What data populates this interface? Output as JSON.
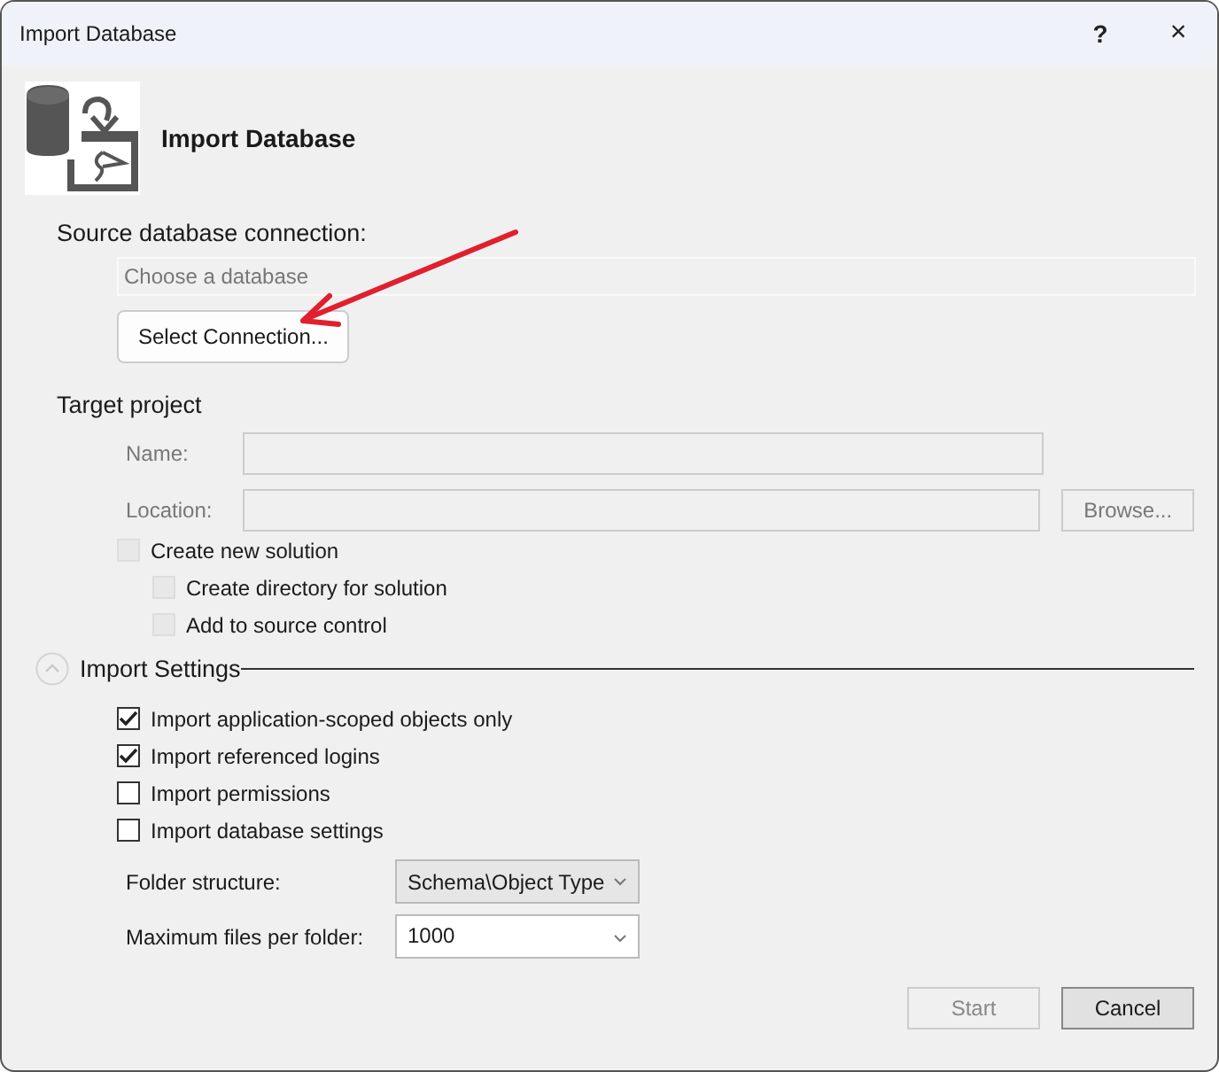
{
  "window": {
    "title": "Import Database",
    "help": "?",
    "close": "×"
  },
  "header": {
    "title": "Import Database"
  },
  "source": {
    "label": "Source database connection:",
    "placeholder": "Choose a database",
    "button": "Select Connection..."
  },
  "target": {
    "heading": "Target project",
    "fields": [
      {
        "label": "Name:",
        "disabled": true
      },
      {
        "label": "Location:",
        "disabled": true,
        "button": "Browse..."
      }
    ],
    "options": [
      {
        "label": "Create new solution",
        "checked": false,
        "disabled": true,
        "children": [
          {
            "label": "Create directory for solution",
            "checked": false,
            "disabled": true
          },
          {
            "label": "Add to source control",
            "checked": false,
            "disabled": true
          }
        ]
      }
    ]
  },
  "import_settings": {
    "heading": "Import Settings",
    "expanded": true,
    "options": [
      {
        "label": "Import application-scoped objects only",
        "checked": true,
        "disabled": false
      },
      {
        "label": "Import referenced logins",
        "checked": true,
        "disabled": false
      },
      {
        "label": "Import permissions",
        "checked": false,
        "disabled": false
      },
      {
        "label": "Import database settings",
        "checked": false,
        "disabled": false
      }
    ],
    "dropdowns": [
      {
        "kind": "dropdown",
        "label": "Folder structure:",
        "value": "Schema\\Object Type"
      },
      {
        "kind": "combo",
        "label": "Maximum files per folder:",
        "value": "1000"
      }
    ]
  },
  "buttons": [
    {
      "label": "Start",
      "disabled": true
    },
    {
      "label": "Cancel",
      "disabled": false
    }
  ],
  "annotation": {
    "kind": "arrow",
    "color": "#e0202e"
  }
}
